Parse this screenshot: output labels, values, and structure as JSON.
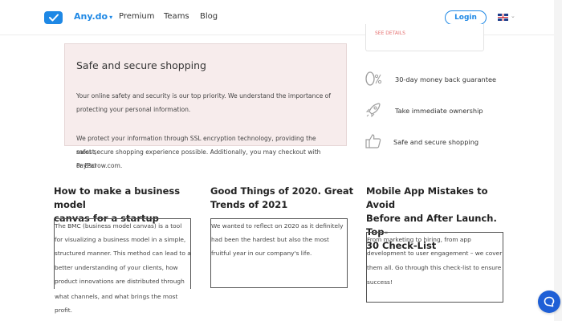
{
  "header": {
    "brand": "Any.do",
    "brand_chevron": "▾",
    "nav": [
      "Premium",
      "Teams",
      "Blog"
    ],
    "login": "Login",
    "language_icon": "uk-flag-icon"
  },
  "colors": {
    "brand_blue": "#1e88e5",
    "info_card_bg": "#f7ecec",
    "chat_blue": "#1e5fd6"
  },
  "info_card": {
    "title": "Safe and secure shopping",
    "p1_line1": "Your online safety and security is our top priority. We understand the importance of",
    "p1_line2": "protecting your personal information.",
    "p2_line1": "We protect your information through SSL encryption technology, providing the safest,",
    "p2_line2": "most secure shopping experience possible. Additionally, you may checkout with PayPal",
    "p2_line3": "or Escrow.com."
  },
  "prev_card": {
    "text": "SEE DETAILS"
  },
  "features": [
    {
      "icon": "zero-percent-icon",
      "label": "30-day money back guarantee"
    },
    {
      "icon": "rocket-icon",
      "label": "Take immediate ownership"
    },
    {
      "icon": "thumbs-up-icon",
      "label": "Safe and secure shopping"
    }
  ],
  "blog": [
    {
      "title_line1": "How to make a business model",
      "title_line2": "canvas for a startup",
      "lines": [
        "The BMC (business model canvas) is a tool",
        "for visualizing a business model in a simple,",
        "structured manner. This method can lead to a",
        "better understanding of your clients, how",
        "product innovations are distributed through",
        "what channels, and what brings the most",
        "profit."
      ]
    },
    {
      "title_line1": "Good Things of 2020. Great",
      "title_line2": "Trends of 2021",
      "lines": [
        "We wanted to reflect on 2020 as it definitely",
        "had been the hardest but also the most",
        "fruitful year in our company's life."
      ]
    },
    {
      "title_line1": "Mobile App Mistakes to Avoid",
      "title_line2": "Before and After Launch. Top-",
      "title_line3": "30 Check-List",
      "lines": [
        "From marketing to hiring, from app",
        "development to user engagement – we cover",
        "them all. Go through this check-list to ensure",
        "success!"
      ]
    }
  ],
  "chat": {
    "icon": "chat-bubble-icon"
  }
}
